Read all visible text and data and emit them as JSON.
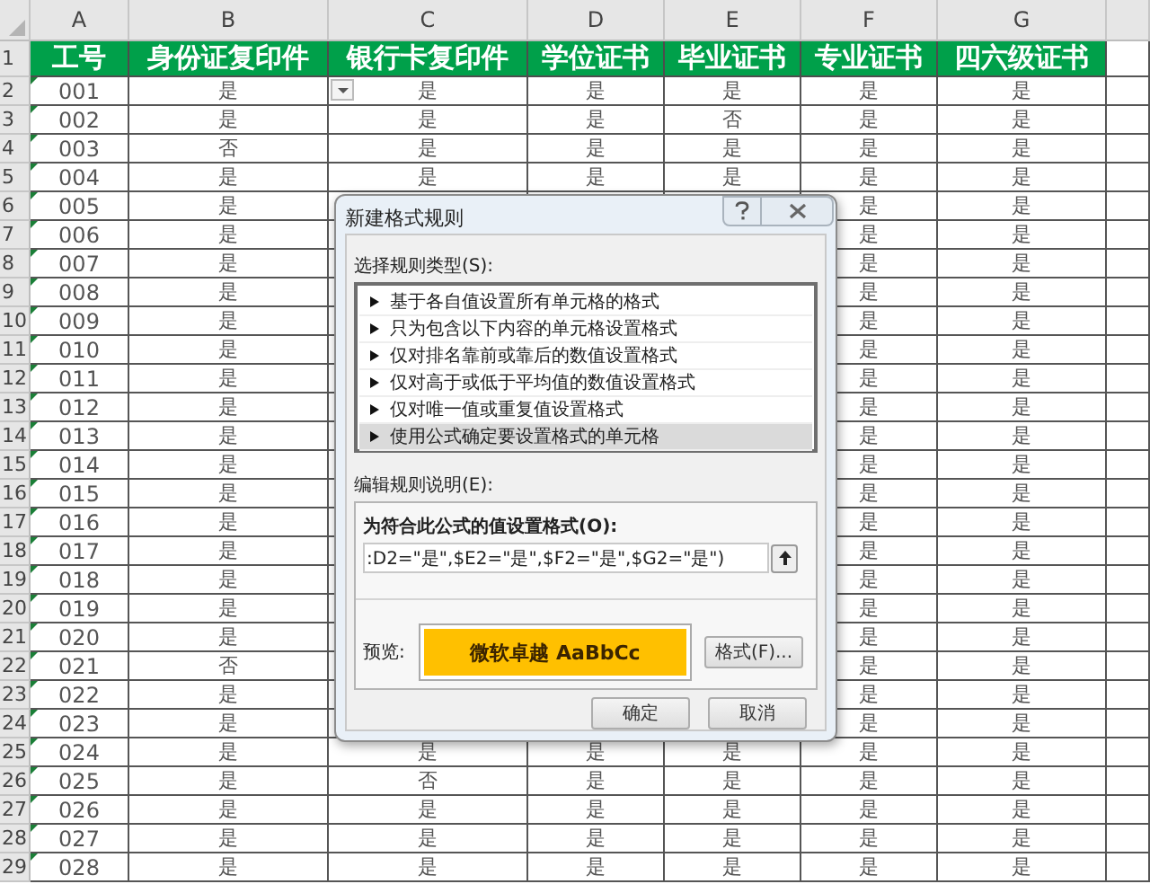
{
  "sheet": {
    "column_letters": [
      "A",
      "B",
      "C",
      "D",
      "E",
      "F",
      "G"
    ],
    "header_row_number": "1",
    "headers": [
      "工号",
      "身份证复印件",
      "银行卡复印件",
      "学位证书",
      "毕业证书",
      "专业证书",
      "四六级证书"
    ],
    "rows": [
      {
        "number": "2",
        "dropdown": true,
        "cells": {
          "A": "001",
          "B": "是",
          "C": "是",
          "D": "是",
          "E": "是",
          "F": "是",
          "G": "是"
        }
      },
      {
        "number": "3",
        "dropdown": false,
        "cells": {
          "A": "002",
          "B": "是",
          "C": "是",
          "D": "是",
          "E": "否",
          "F": "是",
          "G": "是"
        }
      },
      {
        "number": "4",
        "dropdown": false,
        "cells": {
          "A": "003",
          "B": "否",
          "C": "是",
          "D": "是",
          "E": "是",
          "F": "是",
          "G": "是"
        }
      },
      {
        "number": "5",
        "dropdown": false,
        "cells": {
          "A": "004",
          "B": "是",
          "C": "是",
          "D": "是",
          "E": "是",
          "F": "是",
          "G": "是"
        }
      },
      {
        "number": "6",
        "dropdown": false,
        "cells": {
          "A": "005",
          "B": "是",
          "F": "是",
          "G": "是"
        }
      },
      {
        "number": "7",
        "dropdown": false,
        "cells": {
          "A": "006",
          "B": "是",
          "F": "是",
          "G": "是"
        }
      },
      {
        "number": "8",
        "dropdown": false,
        "cells": {
          "A": "007",
          "B": "是",
          "F": "是",
          "G": "是"
        }
      },
      {
        "number": "9",
        "dropdown": false,
        "cells": {
          "A": "008",
          "B": "是",
          "F": "是",
          "G": "是"
        }
      },
      {
        "number": "10",
        "dropdown": false,
        "cells": {
          "A": "009",
          "B": "是",
          "F": "是",
          "G": "是"
        }
      },
      {
        "number": "11",
        "dropdown": false,
        "cells": {
          "A": "010",
          "B": "是",
          "F": "是",
          "G": "是"
        }
      },
      {
        "number": "12",
        "dropdown": false,
        "cells": {
          "A": "011",
          "B": "是",
          "F": "是",
          "G": "是"
        }
      },
      {
        "number": "13",
        "dropdown": false,
        "cells": {
          "A": "012",
          "B": "是",
          "F": "是",
          "G": "是"
        }
      },
      {
        "number": "14",
        "dropdown": false,
        "cells": {
          "A": "013",
          "B": "是",
          "F": "是",
          "G": "是"
        }
      },
      {
        "number": "15",
        "dropdown": false,
        "cells": {
          "A": "014",
          "B": "是",
          "F": "是",
          "G": "是"
        }
      },
      {
        "number": "16",
        "dropdown": false,
        "cells": {
          "A": "015",
          "B": "是",
          "F": "是",
          "G": "是"
        }
      },
      {
        "number": "17",
        "dropdown": false,
        "cells": {
          "A": "016",
          "B": "是",
          "F": "是",
          "G": "是"
        }
      },
      {
        "number": "18",
        "dropdown": false,
        "cells": {
          "A": "017",
          "B": "是",
          "F": "是",
          "G": "是"
        }
      },
      {
        "number": "19",
        "dropdown": false,
        "cells": {
          "A": "018",
          "B": "是",
          "F": "是",
          "G": "是"
        }
      },
      {
        "number": "20",
        "dropdown": false,
        "cells": {
          "A": "019",
          "B": "是",
          "F": "是",
          "G": "是"
        }
      },
      {
        "number": "21",
        "dropdown": false,
        "cells": {
          "A": "020",
          "B": "是",
          "F": "是",
          "G": "是"
        }
      },
      {
        "number": "22",
        "dropdown": false,
        "cells": {
          "A": "021",
          "B": "否",
          "F": "是",
          "G": "是"
        }
      },
      {
        "number": "23",
        "dropdown": false,
        "cells": {
          "A": "022",
          "B": "是",
          "F": "是",
          "G": "是"
        }
      },
      {
        "number": "24",
        "dropdown": false,
        "cells": {
          "A": "023",
          "B": "是",
          "F": "是",
          "G": "是"
        }
      },
      {
        "number": "25",
        "dropdown": false,
        "cells": {
          "A": "024",
          "B": "是",
          "C": "是",
          "D": "是",
          "E": "是",
          "F": "是",
          "G": "是"
        }
      },
      {
        "number": "26",
        "dropdown": false,
        "cells": {
          "A": "025",
          "B": "是",
          "C": "否",
          "D": "是",
          "E": "是",
          "F": "是",
          "G": "是"
        }
      },
      {
        "number": "27",
        "dropdown": false,
        "cells": {
          "A": "026",
          "B": "是",
          "C": "是",
          "D": "是",
          "E": "是",
          "F": "是",
          "G": "是"
        }
      },
      {
        "number": "28",
        "dropdown": false,
        "cells": {
          "A": "027",
          "B": "是",
          "C": "是",
          "D": "是",
          "E": "是",
          "F": "是",
          "G": "是"
        }
      },
      {
        "number": "29",
        "dropdown": false,
        "cells": {
          "A": "028",
          "B": "是",
          "C": "是",
          "D": "是",
          "E": "是",
          "F": "是",
          "G": "是"
        }
      }
    ]
  },
  "dialog": {
    "title": "新建格式规则",
    "type_label": "选择规则类型(S):",
    "rule_types": [
      {
        "label": "基于各自值设置所有单元格的格式",
        "selected": false
      },
      {
        "label": "只为包含以下内容的单元格设置格式",
        "selected": false
      },
      {
        "label": "仅对排名靠前或靠后的数值设置格式",
        "selected": false
      },
      {
        "label": "仅对高于或低于平均值的数值设置格式",
        "selected": false
      },
      {
        "label": "仅对唯一值或重复值设置格式",
        "selected": false
      },
      {
        "label": "使用公式确定要设置格式的单元格",
        "selected": true
      }
    ],
    "description_label": "编辑规则说明(E):",
    "formula_label": "为符合此公式的值设置格式(O):",
    "formula": ":D2=\"是\",$E2=\"是\",$F2=\"是\",$G2=\"是\")",
    "preview_label": "预览:",
    "preview_text": "微软卓越 AaBbCc",
    "format_button": "格式(F)...",
    "buttons": [
      "确定",
      "取消"
    ]
  }
}
